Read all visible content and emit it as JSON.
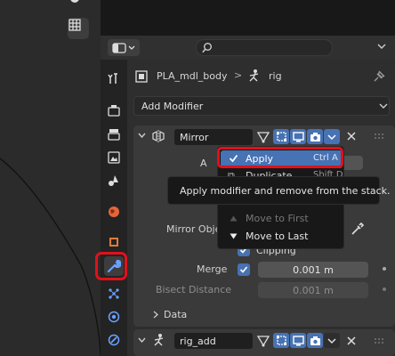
{
  "header": {
    "editor_icon": "editor-type-icon",
    "search_placeholder": ""
  },
  "breadcrumb": {
    "object": "PLA_mdl_body",
    "separator": ">",
    "armature": "rig"
  },
  "add_modifier": {
    "label": "Add Modifier"
  },
  "mirror_modifier": {
    "name": "Mirror",
    "partial_label_a": "A",
    "mirror_object_label": "Mirror Obje",
    "clipping_label": "Clipping",
    "merge_label": "Merge",
    "merge_value": "0.001 m",
    "bisect_label": "Bisect Distance",
    "bisect_value": "0.001 m",
    "data_label": "Data"
  },
  "menu": {
    "items": [
      {
        "label": "Apply",
        "shortcut": "Ctrl A"
      },
      {
        "label": "Duplicate",
        "shortcut": "Shift D"
      },
      {
        "label": "Move to First"
      },
      {
        "label": "Move to Last"
      }
    ]
  },
  "tooltip": {
    "text": "Apply modifier and remove from the stack."
  },
  "second_modifier": {
    "name": "rig_add"
  },
  "colors": {
    "accent": "#4772b3",
    "highlight_outline": "#e0111b"
  }
}
